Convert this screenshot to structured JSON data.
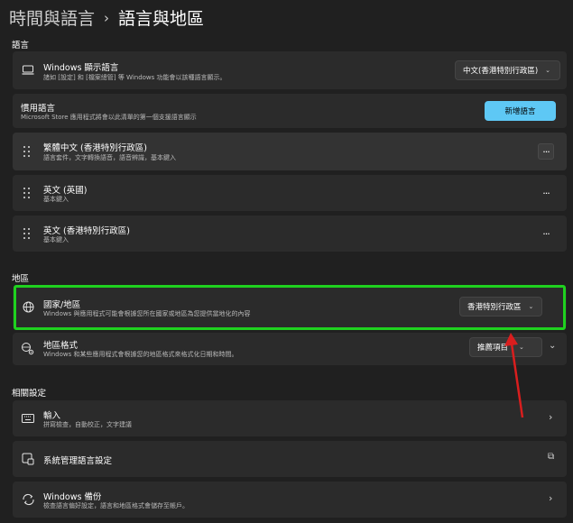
{
  "breadcrumb": {
    "parent": "時間與語言",
    "separator": "›",
    "current": "語言與地區"
  },
  "sections": {
    "language": "語言",
    "region": "地區",
    "related": "相關設定"
  },
  "display_language": {
    "title": "Windows 顯示語言",
    "subtitle": "諸如 [設定] 和 [檔案總管] 等 Windows 功能會以該種語言顯示。",
    "value": "中文(香港特別行政區)"
  },
  "preferred_languages": {
    "title": "慣用語言",
    "subtitle": "Microsoft Store 應用程式將會以此清單的第一個支援語言顯示",
    "add_button": "新增語言"
  },
  "languages": [
    {
      "title": "繁體中文 (香港特別行政區)",
      "subtitle": "語言套件，文字轉換語音，語音辨識，基本鍵入"
    },
    {
      "title": "英文 (英國)",
      "subtitle": "基本鍵入"
    },
    {
      "title": "英文 (香港特別行政區)",
      "subtitle": "基本鍵入"
    }
  ],
  "more_glyph": "···",
  "country": {
    "title": "國家/地區",
    "subtitle": "Windows 與應用程式可能會根據您所在國家或地區為您提供當地化的內容",
    "value": "香港特別行政區"
  },
  "regional_format": {
    "title": "地區格式",
    "subtitle": "Windows 和某些應用程式會根據您的地區格式來格式化日期和時間。",
    "value": "推薦項目"
  },
  "related": [
    {
      "title": "輸入",
      "subtitle": "拼寫檢查，自動校正，文字建議",
      "icon": "keyboard-icon",
      "action": "›"
    },
    {
      "title": "系統管理語言設定",
      "subtitle": "",
      "icon": "admin-language-icon",
      "action": "⧉"
    },
    {
      "title": "Windows 備份",
      "subtitle": "檢查語言偏好設定，語言和地區格式會儲存至帳戶。",
      "icon": "backup-sync-icon",
      "action": "›"
    }
  ],
  "colors": {
    "accent": "#5ec8f5",
    "highlight_box": "#1fd11f",
    "annotation_arrow": "#d91e1e",
    "background": "#202020",
    "card": "#2b2b2b"
  }
}
